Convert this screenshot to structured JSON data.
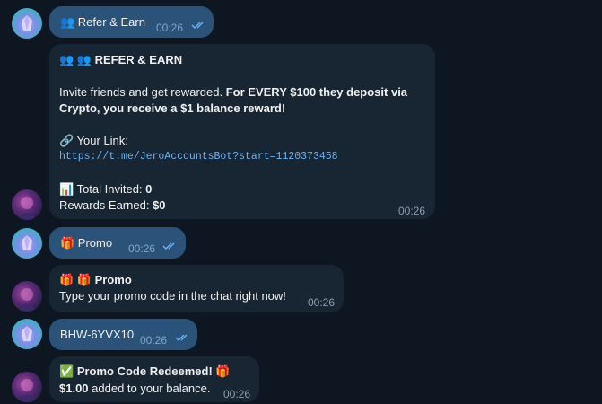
{
  "messages": [
    {
      "text": "👥 Refer & Earn",
      "time": "00:26"
    },
    {
      "title": "👥 👥 REFER & EARN",
      "line1_plain": "Invite friends and get rewarded. ",
      "line1_bold": "For EVERY $100 they deposit via Crypto, you receive a $1 balance reward!",
      "link_label": "🔗 Your Link:",
      "link_url": "https://t.me/JeroAccountsBot?start=1120373458",
      "invited_label": "📊 Total Invited: ",
      "invited_value": "0",
      "rewards_label": "Rewards Earned: ",
      "rewards_value": "$0",
      "time": "00:26"
    },
    {
      "text": "🎁 Promo",
      "time": "00:26"
    },
    {
      "title_emoji": "🎁 🎁 ",
      "title": "Promo",
      "body": "Type your promo code in the chat right now!",
      "time": "00:26"
    },
    {
      "text": "BHW-6YVX10",
      "time": "00:26"
    },
    {
      "title_emoji": "✅ ",
      "title": "Promo Code Redeemed!",
      "title_emoji_end": " 🎁",
      "amount": "$1.00",
      "body": " added to your balance.",
      "time": "00:26"
    }
  ],
  "colors": {
    "background": "#0e1621",
    "incoming_bubble": "#182533",
    "outgoing_bubble": "#2b5278",
    "link": "#6ab3f3"
  },
  "icons": {
    "user_avatar": "crystal-user-avatar",
    "bot_avatar": "bot-avatar",
    "read_receipt": "double-check-icon"
  }
}
